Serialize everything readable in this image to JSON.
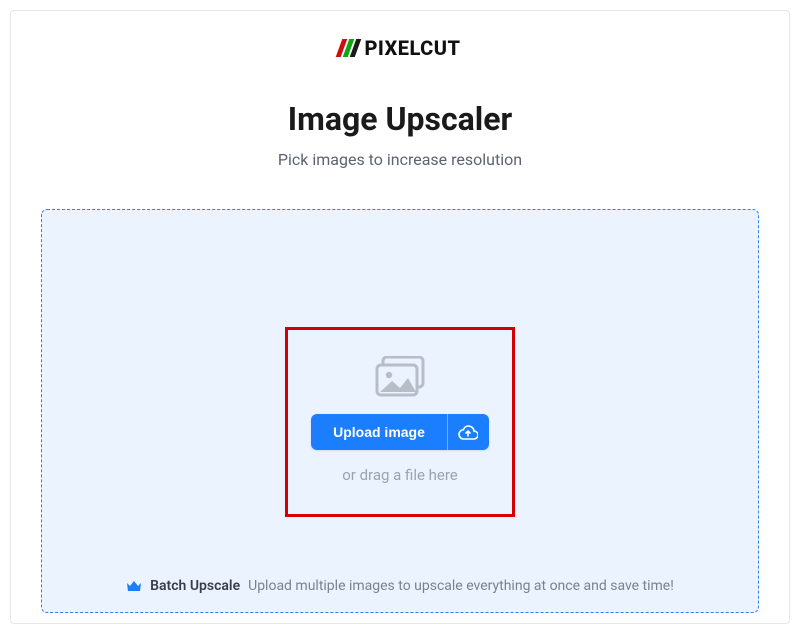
{
  "logo": {
    "text": "PIXELCUT"
  },
  "header": {
    "title": "Image Upscaler",
    "subtitle": "Pick images to increase resolution"
  },
  "upload": {
    "button_label": "Upload image",
    "drag_text": "or drag a file here"
  },
  "batch": {
    "label": "Batch Upscale",
    "description": "Upload multiple images to upscale everything at once and save time!"
  }
}
